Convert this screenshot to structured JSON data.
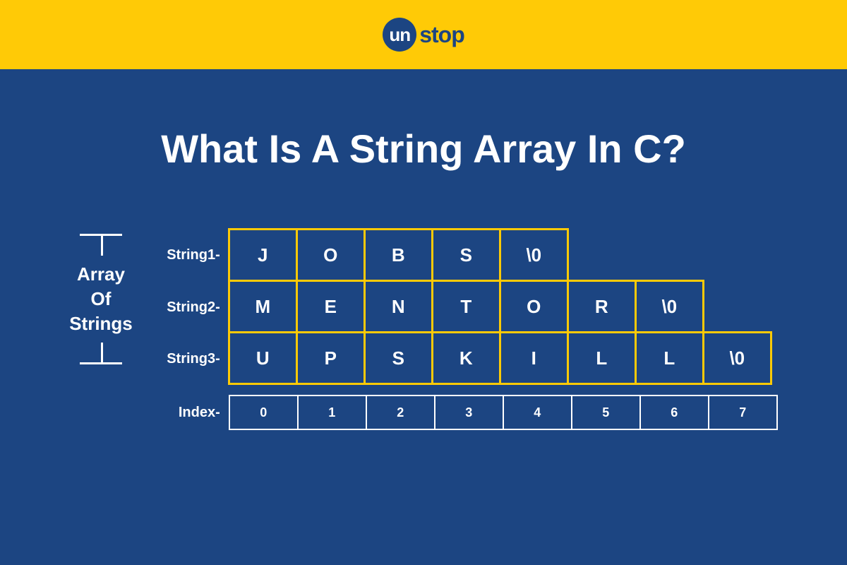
{
  "logo": {
    "circle_text": "un",
    "side_text": "stop"
  },
  "title": "What Is A String Array In C?",
  "bracket_label": [
    "Array",
    "Of",
    "Strings"
  ],
  "rows": [
    {
      "label": "String1-",
      "cells": [
        "J",
        "O",
        "B",
        "S",
        "\\0"
      ]
    },
    {
      "label": "String2-",
      "cells": [
        "M",
        "E",
        "N",
        "T",
        "O",
        "R",
        "\\0"
      ]
    },
    {
      "label": "String3-",
      "cells": [
        "U",
        "P",
        "S",
        "K",
        "I",
        "L",
        "L",
        "\\0"
      ]
    }
  ],
  "index_label": "Index-",
  "indices": [
    "0",
    "1",
    "2",
    "3",
    "4",
    "5",
    "6",
    "7"
  ]
}
